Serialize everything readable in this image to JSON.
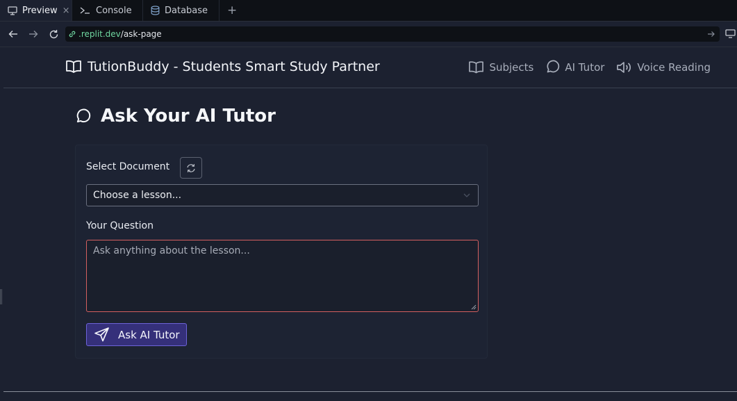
{
  "tabs": [
    {
      "label": "Preview",
      "icon": "monitor-icon",
      "active": true
    },
    {
      "label": "Console",
      "icon": "terminal-icon"
    },
    {
      "label": "Database",
      "icon": "database-icon"
    }
  ],
  "tab_close": "×",
  "tab_add": "+",
  "address": {
    "domain": ".replit.dev",
    "path": "/ask-page"
  },
  "app": {
    "brand": "TutionBuddy - Students Smart Study Partner",
    "nav": [
      {
        "label": "Subjects",
        "icon": "book-icon"
      },
      {
        "label": "AI Tutor",
        "icon": "chat-bubble-icon"
      },
      {
        "label": "Voice Reading",
        "icon": "speaker-icon"
      }
    ]
  },
  "page": {
    "title": "Ask Your AI Tutor"
  },
  "form": {
    "document_label": "Select Document",
    "select_value": "Choose a lesson...",
    "question_label": "Your Question",
    "question_placeholder": "Ask anything about the lesson...",
    "submit_label": "Ask AI Tutor"
  },
  "colors": {
    "background": "#1c2130",
    "accent_button": "#35307a",
    "accent_border": "#6d63d9",
    "error_border": "#d46060",
    "url_domain": "#6fd6a0"
  }
}
